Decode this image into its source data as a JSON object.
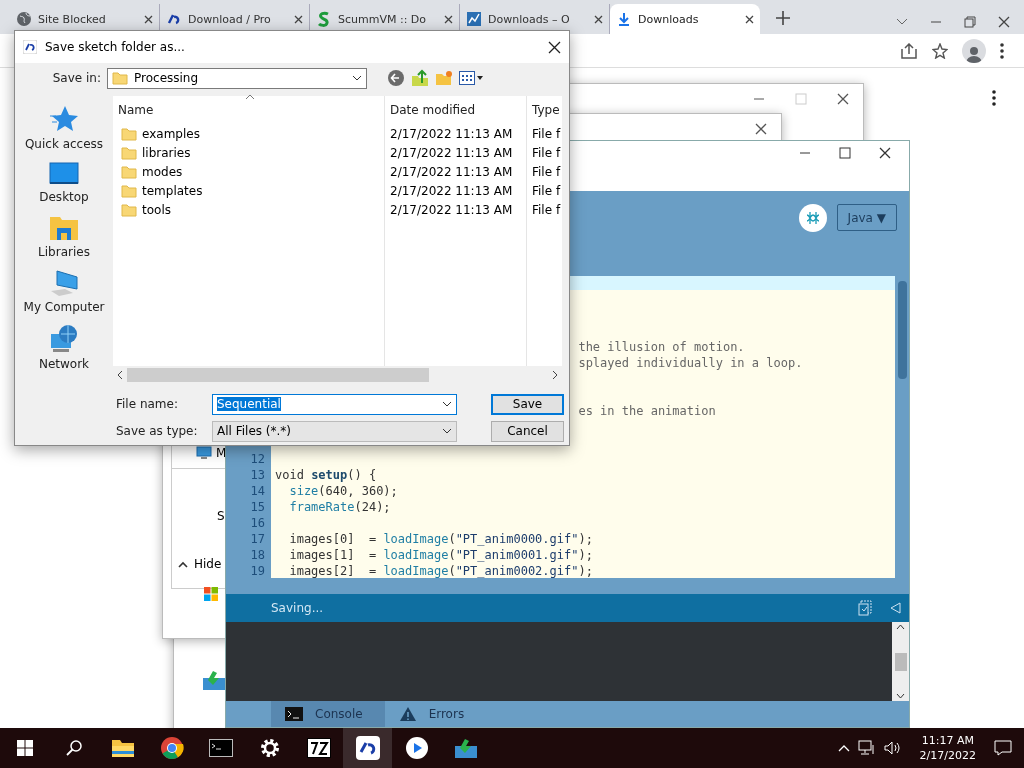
{
  "browser": {
    "tabs": [
      {
        "title": "Site Blocked",
        "kind": "globe",
        "selected": false
      },
      {
        "title": "Download / Pro",
        "kind": "processing",
        "selected": false
      },
      {
        "title": "ScummVM :: Do",
        "kind": "scumm",
        "selected": false
      },
      {
        "title": "Downloads – O",
        "kind": "chart",
        "selected": false
      },
      {
        "title": "Downloads",
        "kind": "download",
        "selected": true
      }
    ]
  },
  "background_window": {
    "items": [
      {
        "kind": "computer",
        "label": "M"
      },
      {
        "kind": "text",
        "label": "S"
      },
      {
        "kind": "hide",
        "label": "Hide"
      }
    ]
  },
  "editor_window": {
    "mode_button": "Java ▼",
    "code_lines": [
      {
        "kind": "clipped",
        "tokens": [
          {
            "kind": "comment",
            "text": "the illusion of motion."
          }
        ]
      },
      {
        "kind": "clipped",
        "tokens": [
          {
            "kind": "comment",
            "text": "splayed individually in a loop."
          }
        ]
      },
      {
        "kind": "clipped"
      },
      {
        "kind": "clipped"
      },
      {
        "kind": "clipped",
        "tokens": [
          {
            "kind": "comment",
            "text": "es in the animation"
          }
        ]
      },
      {
        "kind": "clipped"
      },
      {
        "kind": "clipped"
      },
      {
        "kind": "full",
        "number": "12"
      },
      {
        "kind": "full",
        "number": "13",
        "tokens": [
          {
            "kind": "keyword",
            "text": "void "
          },
          {
            "kind": "def",
            "text": "setup"
          },
          {
            "kind": "plain",
            "text": "() {"
          }
        ]
      },
      {
        "kind": "full",
        "number": "14",
        "tokens": [
          {
            "kind": "fn",
            "text": "size",
            "indent": true
          },
          {
            "kind": "plain",
            "text": "(640, 360);"
          }
        ]
      },
      {
        "kind": "full",
        "number": "15",
        "tokens": [
          {
            "kind": "fn",
            "text": "frameRate",
            "indent": true
          },
          {
            "kind": "plain",
            "text": "(24);"
          }
        ]
      },
      {
        "kind": "full",
        "number": "16"
      },
      {
        "kind": "full",
        "number": "17",
        "tokens": [
          {
            "kind": "plain",
            "text": "  images[0]  = "
          },
          {
            "kind": "fn",
            "text": "loadImage"
          },
          {
            "kind": "plain",
            "text": "("
          },
          {
            "kind": "string",
            "text": "\"PT_anim0000.gif\""
          },
          {
            "kind": "plain",
            "text": ");"
          }
        ]
      },
      {
        "kind": "full",
        "number": "18",
        "tokens": [
          {
            "kind": "plain",
            "text": "  images[1]  = "
          },
          {
            "kind": "fn",
            "text": "loadImage"
          },
          {
            "kind": "plain",
            "text": "("
          },
          {
            "kind": "string",
            "text": "\"PT_anim0001.gif\""
          },
          {
            "kind": "plain",
            "text": ");"
          }
        ]
      },
      {
        "kind": "full",
        "number": "19",
        "tokens": [
          {
            "kind": "plain",
            "text": "  images[2]  = "
          },
          {
            "kind": "fn",
            "text": "loadImage"
          },
          {
            "kind": "plain",
            "text": "("
          },
          {
            "kind": "string",
            "text": "\"PT_anim0002.gif\""
          },
          {
            "kind": "plain",
            "text": ");"
          }
        ]
      }
    ],
    "status": "Saving...",
    "console_tabs": [
      {
        "label": "Console",
        "kind": "terminal",
        "selected": true
      },
      {
        "label": "Errors",
        "kind": "warning",
        "selected": false
      }
    ]
  },
  "dialog": {
    "title": "Save sketch folder as...",
    "save_in_label": "Save in:",
    "save_in": "Processing",
    "places": [
      {
        "kind": "star",
        "label": "Quick access"
      },
      {
        "kind": "desktop",
        "label": "Desktop"
      },
      {
        "kind": "libraries",
        "label": "Libraries"
      },
      {
        "kind": "computer",
        "label": "My Computer"
      },
      {
        "kind": "network",
        "label": "Network"
      }
    ],
    "columns": [
      "Name",
      "Date modified",
      "Type"
    ],
    "rows": [
      {
        "name": "examples",
        "date": "2/17/2022 11:13 AM",
        "type": "File f"
      },
      {
        "name": "libraries",
        "date": "2/17/2022 11:13 AM",
        "type": "File f"
      },
      {
        "name": "modes",
        "date": "2/17/2022 11:13 AM",
        "type": "File f"
      },
      {
        "name": "templates",
        "date": "2/17/2022 11:13 AM",
        "type": "File f"
      },
      {
        "name": "tools",
        "date": "2/17/2022 11:13 AM",
        "type": "File f"
      }
    ],
    "file_name_label": "File name:",
    "file_name": "Sequential",
    "type_label": "Save as type:",
    "file_type": "All Files (*.*)",
    "buttons": [
      "Save",
      "Cancel"
    ]
  },
  "taskbar": {
    "apps": [
      {
        "kind": "explorer",
        "active": false
      },
      {
        "kind": "chrome",
        "active": false
      },
      {
        "kind": "terminal",
        "active": false
      },
      {
        "kind": "settings",
        "active": false
      },
      {
        "kind": "sevenzip",
        "active": false
      },
      {
        "kind": "processing",
        "active": true
      },
      {
        "kind": "player",
        "active": false
      },
      {
        "kind": "installer",
        "active": false
      }
    ],
    "time": "11:17 AM",
    "date": "2/17/2022"
  }
}
